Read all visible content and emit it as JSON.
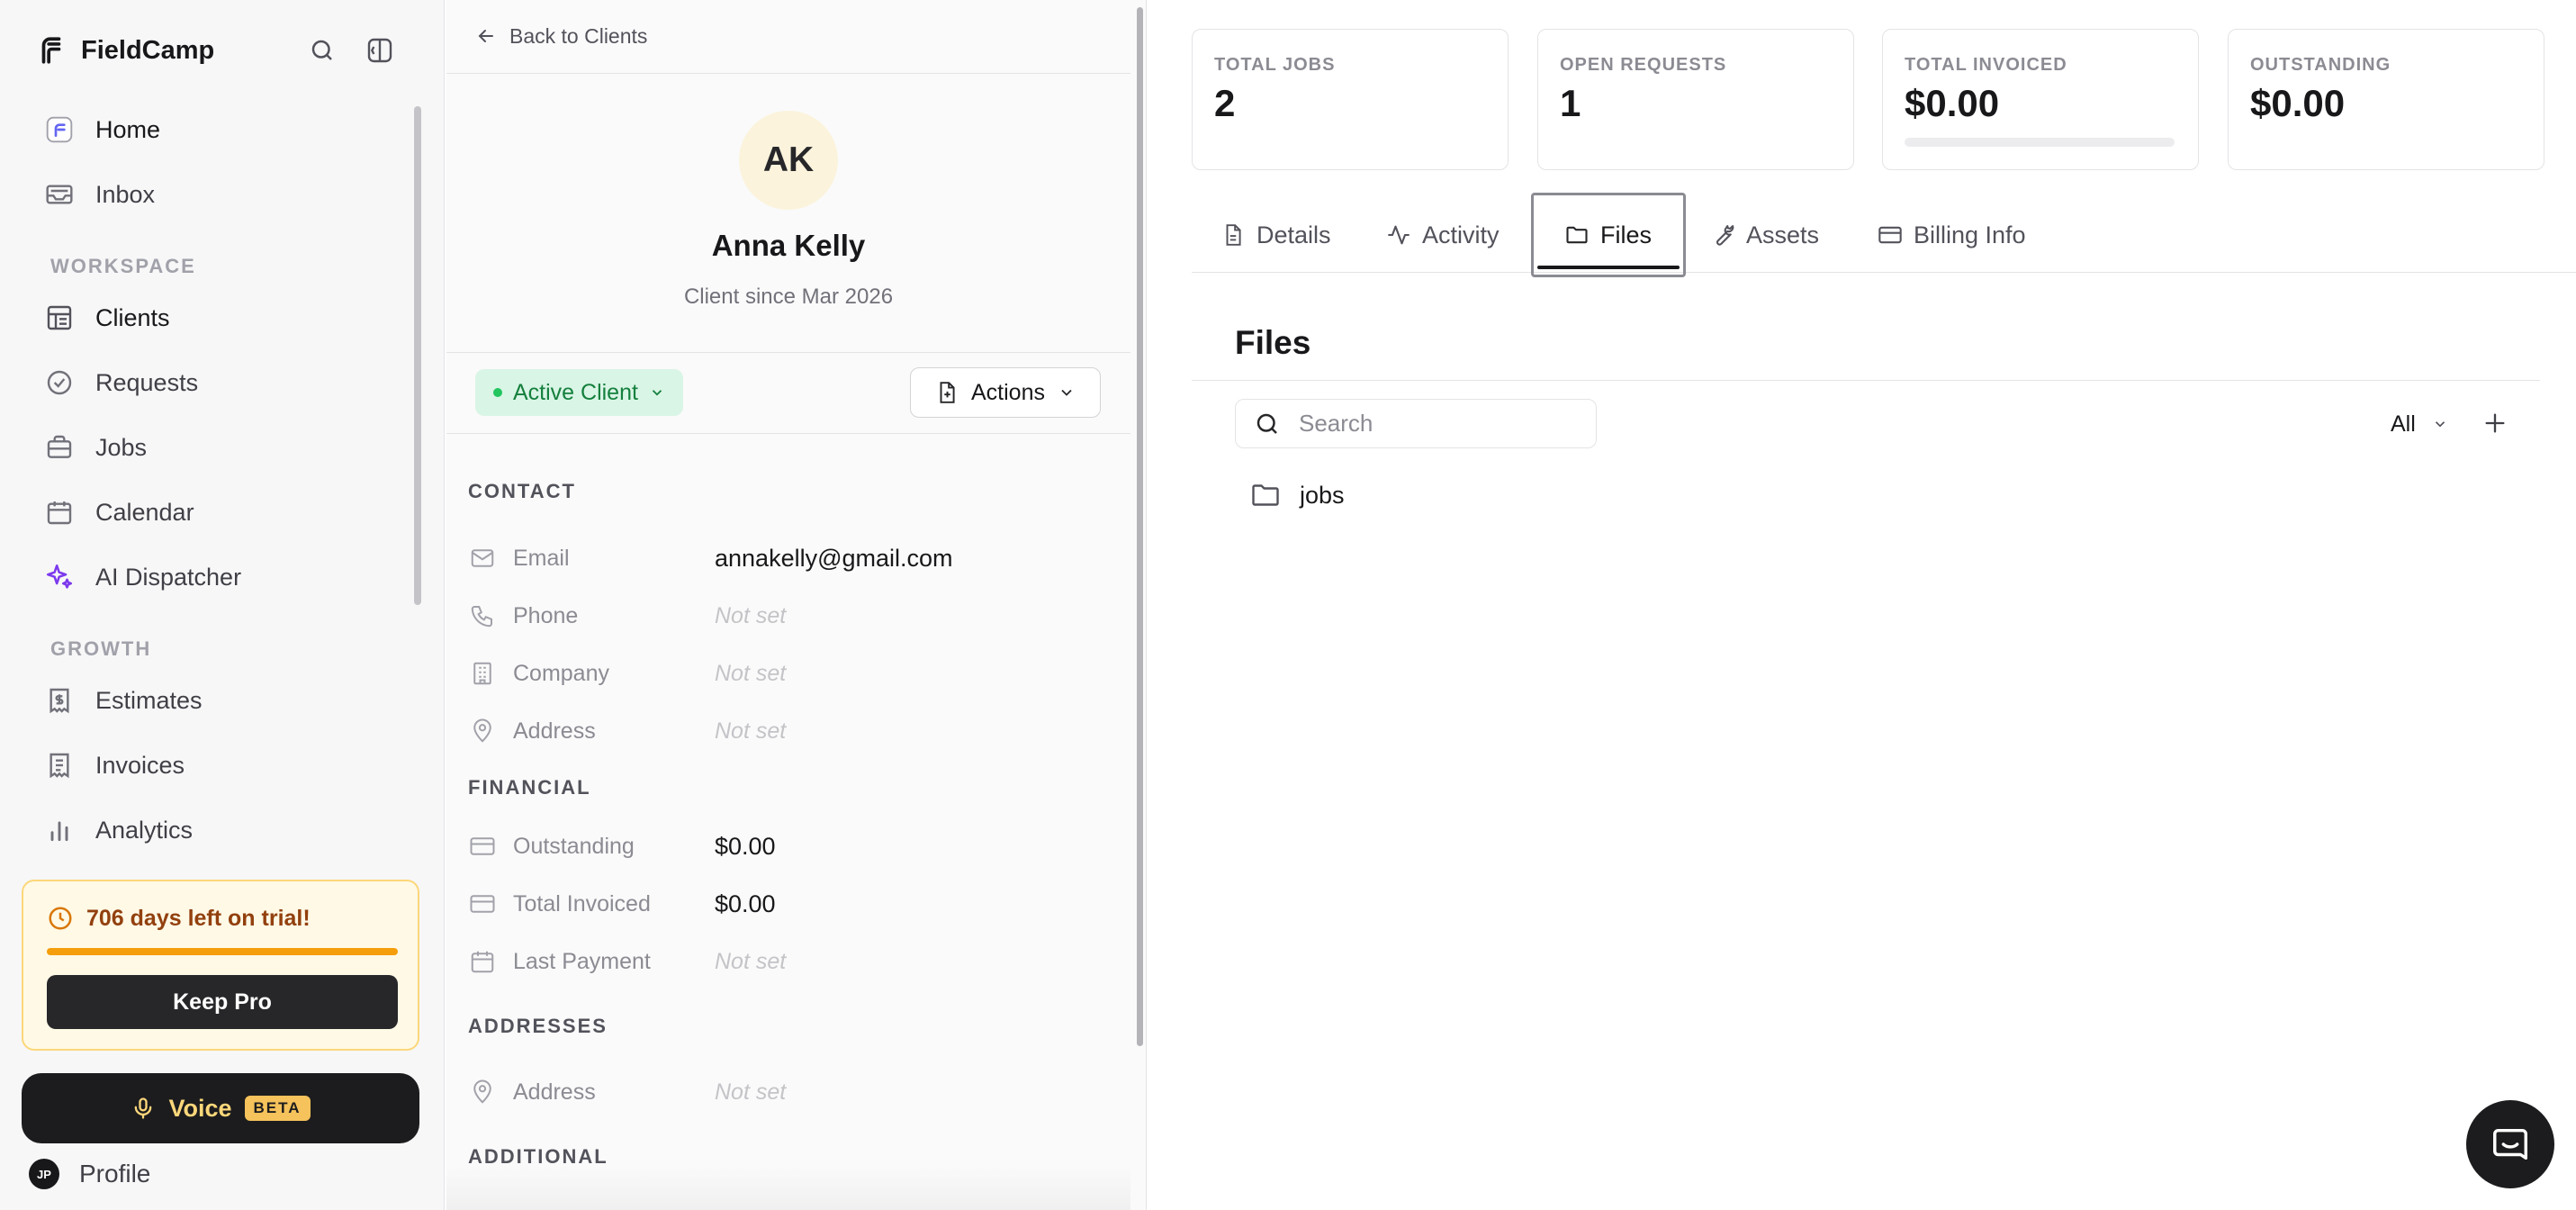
{
  "app": {
    "name": "FieldCamp"
  },
  "sidebar": {
    "items_top": [
      {
        "label": "Home"
      },
      {
        "label": "Inbox"
      }
    ],
    "workspace_label": "WORKSPACE",
    "workspace_items": [
      {
        "label": "Clients"
      },
      {
        "label": "Requests"
      },
      {
        "label": "Jobs"
      },
      {
        "label": "Calendar"
      },
      {
        "label": "AI Dispatcher"
      }
    ],
    "growth_label": "GROWTH",
    "growth_items": [
      {
        "label": "Estimates"
      },
      {
        "label": "Invoices"
      },
      {
        "label": "Analytics"
      }
    ],
    "trial": {
      "text": "706 days left on trial!",
      "button": "Keep Pro"
    },
    "voice": {
      "label": "Voice",
      "badge": "BETA"
    },
    "profile": {
      "initials": "JP",
      "label": "Profile"
    }
  },
  "client_panel": {
    "back_label": "Back to Clients",
    "initials": "AK",
    "name": "Anna Kelly",
    "since": "Client since Mar 2026",
    "status": "Active Client",
    "actions_label": "Actions",
    "sections": {
      "contact": "CONTACT",
      "financial": "FINANCIAL",
      "addresses": "ADDRESSES",
      "additional": "ADDITIONAL"
    },
    "contact": [
      {
        "label": "Email",
        "value": "annakelly@gmail.com"
      },
      {
        "label": "Phone",
        "value": "Not set"
      },
      {
        "label": "Company",
        "value": "Not set"
      },
      {
        "label": "Address",
        "value": "Not set"
      }
    ],
    "financial": [
      {
        "label": "Outstanding",
        "value": "$0.00"
      },
      {
        "label": "Total Invoiced",
        "value": "$0.00"
      },
      {
        "label": "Last Payment",
        "value": "Not set"
      }
    ],
    "addresses": [
      {
        "label": "Address",
        "value": "Not set"
      }
    ]
  },
  "stats": [
    {
      "label": "TOTAL JOBS",
      "value": "2"
    },
    {
      "label": "OPEN REQUESTS",
      "value": "1"
    },
    {
      "label": "TOTAL INVOICED",
      "value": "$0.00"
    },
    {
      "label": "OUTSTANDING",
      "value": "$0.00"
    }
  ],
  "tabs": [
    {
      "label": "Details"
    },
    {
      "label": "Activity"
    },
    {
      "label": "Files"
    },
    {
      "label": "Assets"
    },
    {
      "label": "Billing Info"
    }
  ],
  "files": {
    "title": "Files",
    "search_placeholder": "Search",
    "filter": "All",
    "items": [
      {
        "name": "jobs"
      }
    ]
  }
}
